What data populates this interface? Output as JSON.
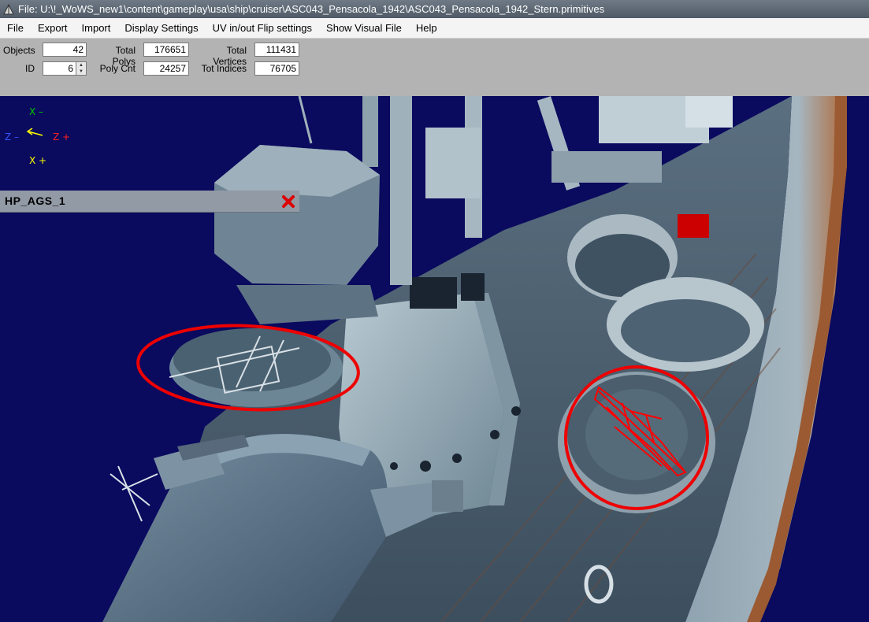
{
  "window": {
    "title": "File: U:\\!_WoWS_new1\\content\\gameplay\\usa\\ship\\cruiser\\ASC043_Pensacola_1942\\ASC043_Pensacola_1942_Stern.primitives"
  },
  "menu": [
    "File",
    "Export",
    "Import",
    "Display Settings",
    "UV in/out Flip settings",
    "Show Visual File",
    "Help"
  ],
  "stats": {
    "objects_label": "Objects",
    "objects": "42",
    "id_label": "ID",
    "id": "6",
    "total_polys_label": "Total Polys",
    "total_polys": "176651",
    "poly_cnt_label": "Poly Cnt",
    "poly_cnt": "24257",
    "total_vertices_label": "Total Vertices",
    "total_vertices": "111431",
    "tot_indices_label": "Tot Indices",
    "tot_indices": "76705"
  },
  "axes": {
    "x_minus": "X –",
    "z_minus": "Z –",
    "z_plus": "Z +",
    "x_plus": "X +"
  },
  "hardpoint_panel": {
    "name": "HP_AGS_1"
  },
  "colors": {
    "background": "#0a0a5e",
    "highlight": "#ff0000",
    "axis_x": "#00cc00",
    "axis_z_neg": "#3355ff",
    "axis_z_pos": "#ff2222",
    "axis_x_pos": "#ffff00"
  }
}
